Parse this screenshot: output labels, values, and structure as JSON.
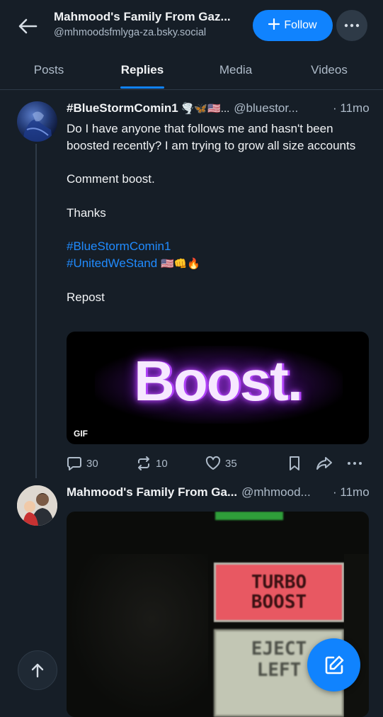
{
  "header": {
    "title": "Mahmood's Family From Gaz...",
    "handle": "@mhmoodsfmlyga-za.bsky.social",
    "follow_label": "Follow"
  },
  "tabs": [
    {
      "label": "Posts"
    },
    {
      "label": "Replies"
    },
    {
      "label": "Media"
    },
    {
      "label": "Videos"
    }
  ],
  "active_tab": "Replies",
  "post1": {
    "author_name": "#BlueStormComin1",
    "author_emojis": "🌪️🦋🇺🇸...",
    "author_handle": "@bluestor...",
    "time": "· 11mo",
    "lines": {
      "l1": "Do I have anyone that follows me and hasn't been boosted recently?  I am trying to grow all size accounts",
      "l2": "Comment boost.",
      "l3": "Thanks",
      "tag1": "#BlueStormComin1",
      "tag2": "#UnitedWeStand",
      "tag2_emojis": "🇺🇸👊🔥",
      "l4": "Repost"
    },
    "media_text": "Boost.",
    "gif_badge": "GIF",
    "replies": "30",
    "reposts": "10",
    "likes": "35"
  },
  "post2": {
    "author_name": "Mahmood's Family From Ga...",
    "author_handle": "@mhmood...",
    "time": "· 11mo",
    "sign_line1": "TURBO",
    "sign_line2": "BOOST",
    "sign2_line1": "EJECT",
    "sign2_line2": "LEFT"
  },
  "colors": {
    "background": "#161e27",
    "accent": "#1083fe",
    "link": "#208bfe",
    "muted": "#aebbc9"
  },
  "icons": {
    "back": "arrow-left-icon",
    "more": "ellipsis-icon",
    "reply": "speech-bubble-icon",
    "repost": "repost-arrows-icon",
    "like": "heart-icon",
    "bookmark": "bookmark-icon",
    "share": "share-arrow-icon",
    "compose": "pencil-square-icon",
    "scroll_top": "arrow-up-icon"
  }
}
